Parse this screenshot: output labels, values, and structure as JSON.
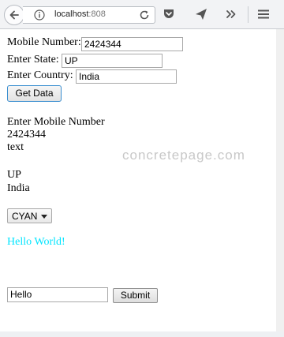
{
  "browser": {
    "url_host": "localhost",
    "url_port": ":808"
  },
  "form": {
    "mobile_label": "Mobile Number:",
    "mobile_value": "2424344",
    "state_label": "Enter State:",
    "state_value": "UP",
    "country_label": "Enter Country:",
    "country_value": "India",
    "get_data_button": "Get Data"
  },
  "output": {
    "prompt": "Enter Mobile Number",
    "mobile": "2424344",
    "text": "text",
    "state": "UP",
    "country": "India"
  },
  "watermark": "concretepage.com",
  "color_select": {
    "selected": "CYAN"
  },
  "hello": {
    "text": "Hello World!",
    "color": "#00e5ff"
  },
  "bottom_form": {
    "input_value": "Hello",
    "submit_button": "Submit"
  }
}
